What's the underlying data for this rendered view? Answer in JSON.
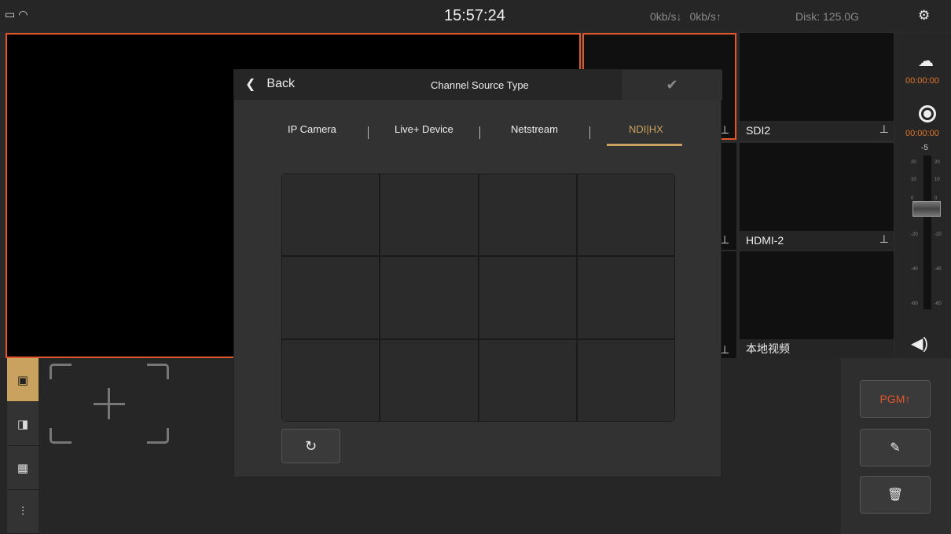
{
  "status_bar": {
    "time": "15:57:24",
    "download_rate": "0kb/s↓",
    "upload_rate": "0kb/s↑",
    "disk": "Disk: 125.0G",
    "icons": [
      "monitor-icon",
      "wifi-icon",
      "gear-icon"
    ]
  },
  "channels": [
    {
      "label": "SDI2"
    },
    {
      "label": "HDMI-2"
    },
    {
      "label": "本地视频"
    }
  ],
  "right_panel": {
    "stream_time": "00:00:00",
    "record_time": "00:00:00",
    "volume_value": "-5",
    "meter_ticks_left": [
      "20",
      "10",
      "0",
      "-20",
      "-40",
      "-60"
    ],
    "meter_ticks_right": [
      "20",
      "10",
      "0",
      "-20",
      "-40",
      "-60"
    ]
  },
  "actions": {
    "pgm_label": "PGM"
  },
  "dialog": {
    "back_label": "Back",
    "title": "Channel Source Type",
    "tabs": [
      {
        "label": "IP Camera"
      },
      {
        "label": "Live+ Device"
      },
      {
        "label": "Netstream"
      },
      {
        "label": "NDI|HX"
      }
    ],
    "active_tab": "NDI|HX",
    "grid_rows": 3,
    "grid_cols": 4
  },
  "colors": {
    "accent_orange": "#e0562a",
    "accent_gold": "#c8a25e"
  }
}
